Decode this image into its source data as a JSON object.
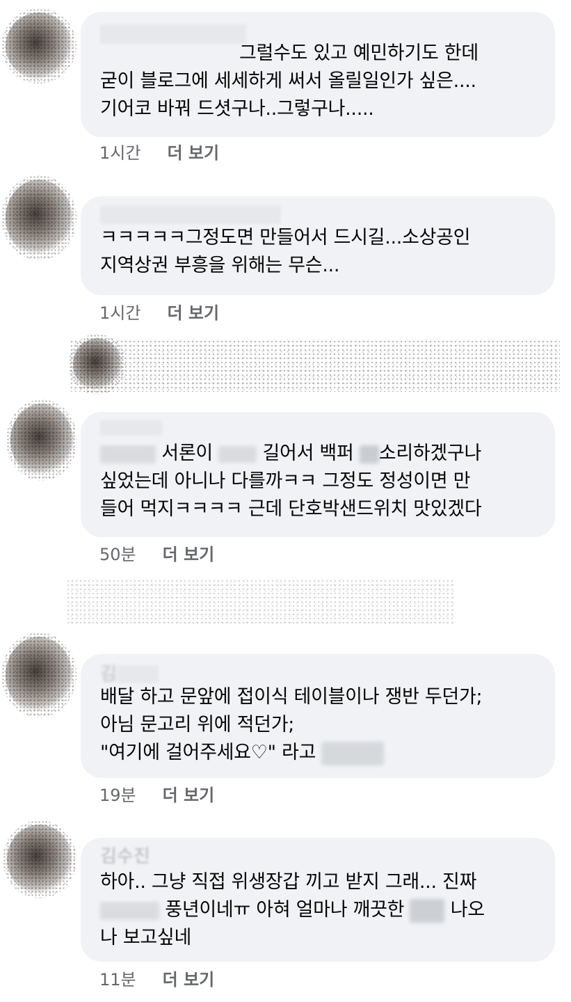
{
  "comments": [
    {
      "name": "",
      "lines": [
        "그럴수도 있고 예민하기도 한데",
        "굳이 블로그에 세세하게 써서 올릴일인가 싶은....",
        "기어코 바꿔 드셧구나..그렇구나....."
      ],
      "time": "1시간",
      "more": "더 보기"
    },
    {
      "name": "",
      "lines": [
        "ㅋㅋㅋㅋㅋ그정도면 만들어서 드시길...소상공인",
        "지역상권 부흥을 위해는 무슨..."
      ],
      "time": "1시간",
      "more": "더 보기"
    },
    {
      "name": "",
      "line1_part1": "서론이",
      "line1_part2": "길어서 백퍼",
      "line1_part3": "소리하겠구나",
      "lines": [
        "싶었는데 아니나 다를까ㅋㅋ 그정도 정성이면 만",
        "들어 먹지ㅋㅋㅋㅋ 근데 단호박샌드위치 맛있겠다"
      ],
      "time": "50분",
      "more": "더 보기"
    },
    {
      "name": "김",
      "lines": [
        "배달 하고 문앞에 접이식 테이블이나 쟁반 두던가;",
        "아님 문고리 위에 적던가;"
      ],
      "line3": "\"여기에 걸어주세요♡\" 라고",
      "time": "19분",
      "more": "더 보기"
    },
    {
      "name": "김수진",
      "line1": "하아.. 그냥 직접 위생장갑 끼고 받지 그래... 진짜",
      "line2_part1": "풍년이네ㅠ 아혀 얼마나 깨끗한",
      "line2_part2": "나오",
      "line3": "나 보고싶네",
      "time": "11분",
      "more": "더 보기"
    }
  ]
}
